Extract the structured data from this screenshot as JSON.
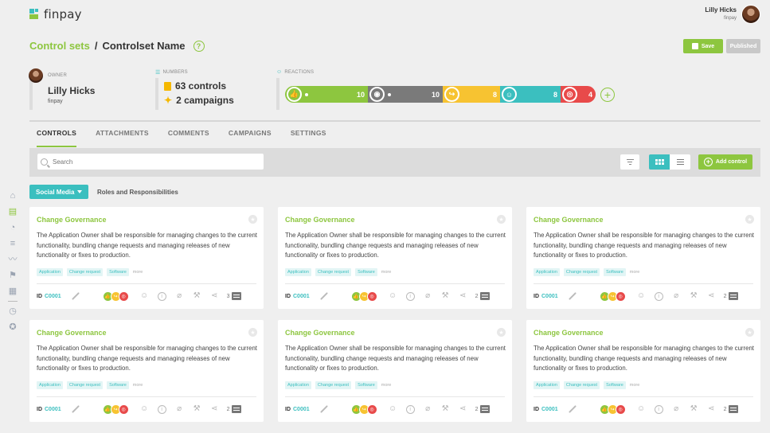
{
  "app": {
    "logo_text": "finpay"
  },
  "user": {
    "name": "Lilly Hicks",
    "org": "finpay"
  },
  "breadcrumb": {
    "link": "Control sets",
    "separator": "/",
    "current": "Controlset Name",
    "help": "?"
  },
  "actions": {
    "save": "Save",
    "published": "Published"
  },
  "owner": {
    "label": "OWNER",
    "name": "Lilly Hicks",
    "org": "finpay"
  },
  "numbers": {
    "label": "NUMBERS",
    "controls": "63 controls",
    "campaigns": "2 campaigns"
  },
  "reactions": {
    "label": "REACTIONS",
    "items": [
      {
        "icon": "thumbs-up-icon",
        "glyph": "👍",
        "count": "10",
        "color": "#8dc63f",
        "width": 104
      },
      {
        "icon": "eye-icon",
        "glyph": "◉",
        "count": "10",
        "color": "#7a7a7a",
        "width": 94
      },
      {
        "icon": "share-arrow-icon",
        "glyph": "↪",
        "count": "8",
        "color": "#f7c331",
        "width": 72
      },
      {
        "icon": "user-group-icon",
        "glyph": "☺",
        "count": "8",
        "color": "#3bbfbf",
        "width": 76
      },
      {
        "icon": "meat-icon",
        "glyph": "◎",
        "count": "4",
        "color": "#e84a4a",
        "width": 44
      }
    ],
    "add": "+"
  },
  "tabs": [
    "CONTROLS",
    "ATTACHMENTS",
    "COMMENTS",
    "CAMPAIGNS",
    "SETTINGS"
  ],
  "search": {
    "placeholder": "Search"
  },
  "toolbar": {
    "add_control": "Add control"
  },
  "category": {
    "active": "Social Media",
    "other": "Roles and Responsibilities"
  },
  "cards": [
    {
      "title": "Change Governance",
      "description": "The Application Owner shall be responsible for managing changes to the current functionality, bundling change requests and managing releases of new functionality or fixes to production.",
      "tags": [
        "Application",
        "Change request",
        "Software"
      ],
      "more": "more",
      "id_label": "ID",
      "id": "C0001",
      "comments": "3"
    },
    {
      "title": "Change Governance",
      "description": "The Application Owner shall be responsible for managing changes to the current functionality, bundling change requests and managing releases of new functionality or fixes to production.",
      "tags": [
        "Application",
        "Change request",
        "Software"
      ],
      "more": "more",
      "id_label": "ID",
      "id": "C0001",
      "comments": "2"
    },
    {
      "title": "Change Governance",
      "description": "The Application Owner shall be responsible for managing changes to the current functionality, bundling change requests and managing releases of new functionality or fixes to production.",
      "tags": [
        "Application",
        "Change request",
        "Software"
      ],
      "more": "more",
      "id_label": "ID",
      "id": "C0001",
      "comments": "2"
    },
    {
      "title": "Change Governance",
      "description": "The Application Owner shall be responsible for managing changes to the current functionality, bundling change requests and managing releases of new functionality or fixes to production.",
      "tags": [
        "Application",
        "Change request",
        "Software"
      ],
      "more": "more",
      "id_label": "ID",
      "id": "C0001",
      "comments": "2"
    },
    {
      "title": "Change Governance",
      "description": "The Application Owner shall be responsible for managing changes to the current functionality, bundling change requests and managing releases of new functionality or fixes to production.",
      "tags": [
        "Application",
        "Change request",
        "Software"
      ],
      "more": "more",
      "id_label": "ID",
      "id": "C0001",
      "comments": "2"
    },
    {
      "title": "Change Governance",
      "description": "The Application Owner shall be responsible for managing changes to the current functionality, bundling change requests and managing releases of new functionality or fixes to production.",
      "tags": [
        "Application",
        "Change request",
        "Software"
      ],
      "more": "more",
      "id_label": "ID",
      "id": "C0001",
      "comments": "2"
    }
  ],
  "colors": {
    "accent": "#8dc63f",
    "teal": "#3bbfbf",
    "yellow": "#f5b800",
    "red": "#e84a4a"
  }
}
